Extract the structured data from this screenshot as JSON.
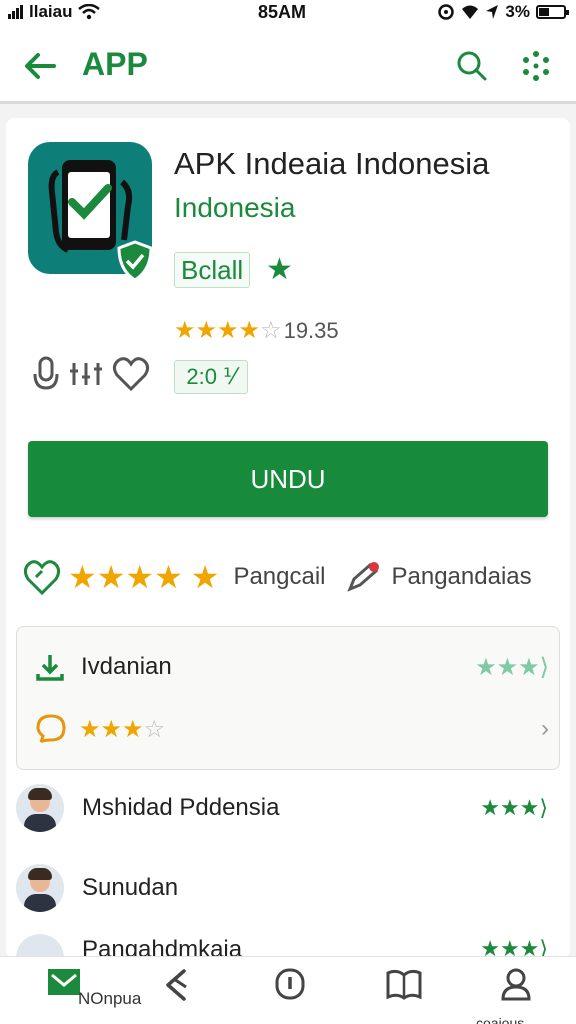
{
  "status_bar": {
    "carrier": "llaiau",
    "time": "85AM",
    "battery": "3%"
  },
  "app_bar": {
    "title": "APP",
    "accent_color": "#1b8a3c"
  },
  "app": {
    "title": "APK Indeaia Indonesia",
    "subtitle": "Indonesia",
    "badge": "Bclall",
    "rating_stars": 4,
    "rating_value": "19.35",
    "version": "2:0 ⅟"
  },
  "install_button": {
    "label": "UNDU"
  },
  "meta_row": {
    "stars": 5,
    "label_1": "Pangcail",
    "label_2": "Pangandaias"
  },
  "details_box": {
    "row1_label": "Ivdanian",
    "row2_stars": 3
  },
  "reviews": [
    {
      "name": "Mshidad Pddensia"
    },
    {
      "name": "Sunudan"
    },
    {
      "name": "Pangahdmkaia"
    }
  ],
  "bottom_nav": {
    "item1_label": "NOnpua",
    "item5_label": "coaious"
  },
  "icons": [
    "back-arrow-icon",
    "search-icon",
    "more-dots-icon",
    "app-phone-check-icon",
    "shield-check-icon",
    "microphone-icon",
    "equalizer-icon",
    "heart-icon",
    "leaf-heart-icon",
    "pencil-icon",
    "download-icon",
    "chat-bubble-icon",
    "home-icon",
    "share-icon",
    "info-icon",
    "book-icon",
    "profile-icon"
  ]
}
